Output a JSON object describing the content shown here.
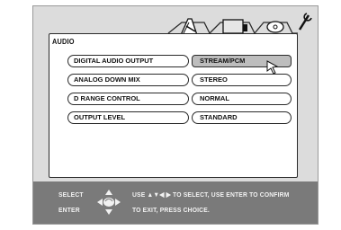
{
  "panel": {
    "title": "AUDIO"
  },
  "tabs": [
    {
      "icon": "pencil-ruler-icon",
      "active": true
    },
    {
      "icon": "monitor-icon",
      "active": false
    },
    {
      "icon": "disc-icon",
      "active": false
    },
    {
      "icon": "wrench-icon",
      "active": false
    }
  ],
  "settings": [
    {
      "label": "DIGITAL AUDIO OUTPUT",
      "value": "STREAM/PCM",
      "selected": true
    },
    {
      "label": "ANALOG DOWN MIX",
      "value": "STEREO",
      "selected": false
    },
    {
      "label": "D RANGE CONTROL",
      "value": "NORMAL",
      "selected": false
    },
    {
      "label": "OUTPUT LEVEL",
      "value": "STANDARD",
      "selected": false
    }
  ],
  "footer": {
    "select_label": "SELECT",
    "enter_label": "ENTER",
    "line1": "USE ▲▼◀ ▶ TO SELECT, USE ENTER TO CONFIRM",
    "line2": "TO EXIT, PRESS CHOICE."
  },
  "colors": {
    "screen_bg": "#dcdcdc",
    "footer_bg": "#7a7a7a",
    "selected_bg": "#bdbdbd"
  }
}
